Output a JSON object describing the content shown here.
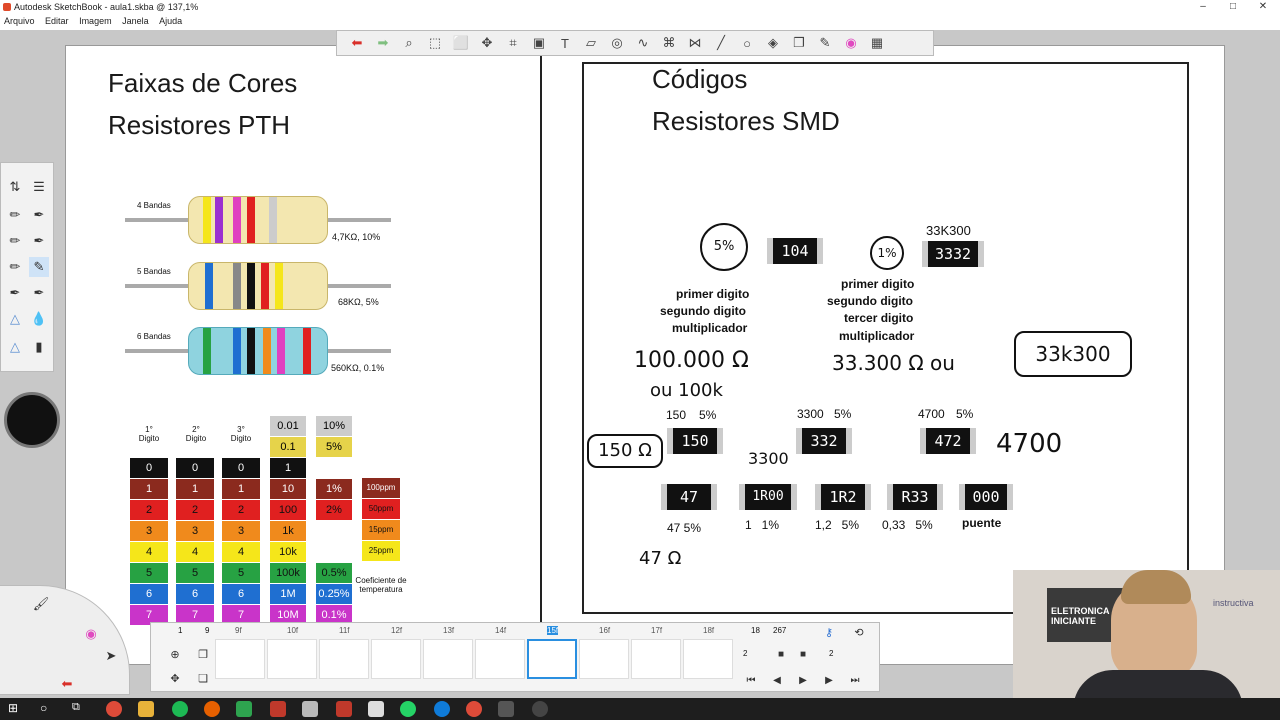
{
  "window": {
    "title": "Autodesk SketchBook - aula1.skba @ 137,1%",
    "minimize": "–",
    "maximize": "□",
    "close": "✕"
  },
  "menu": [
    "Arquivo",
    "Editar",
    "Imagem",
    "Janela",
    "Ajuda"
  ],
  "canvas": {
    "left_title_1": "Faixas de Cores",
    "left_title_2": "Resistores PTH",
    "right_title_1": "Códigos",
    "right_title_2": "Resistores SMD"
  },
  "pth": {
    "band_labels": [
      "4 Bandas",
      "5 Bandas",
      "6 Bandas"
    ],
    "values": [
      "4,7KΩ, 10%",
      "68KΩ, 5%",
      "560KΩ, 0.1%"
    ],
    "column_headers": [
      "1°\nDigito",
      "2°\nDigito",
      "3°\nDigito"
    ],
    "mult_top": [
      "0.01",
      "0.1"
    ],
    "tol_top": [
      "10%",
      "5%"
    ],
    "digits": [
      "0",
      "1",
      "2",
      "3",
      "4",
      "5",
      "6",
      "7"
    ],
    "multipliers": [
      "1",
      "10",
      "100",
      "1k",
      "10k",
      "100k",
      "1M",
      "10M"
    ],
    "tolerances": [
      "1%",
      "2%",
      "0.5%",
      "0.25%",
      "0.1%"
    ],
    "tempco": [
      "100ppm",
      "50ppm",
      "15ppm",
      "25ppm"
    ],
    "tempco_label": "Coeficiente de temperatura",
    "row_colors": [
      "#111111",
      "#8b2a1e",
      "#e02020",
      "#f08a1c",
      "#f5e61a",
      "#27a243",
      "#1f6fd1",
      "#c934c9",
      "#888888"
    ]
  },
  "smd": {
    "chip1": "104",
    "chip1_tol": "5%",
    "chip2": "3332",
    "chip2_tol": "1%",
    "chip2_top": "33K300",
    "labels1": [
      "primer digito",
      "segundo digito",
      "multiplicador"
    ],
    "labels2": [
      "primer digito",
      "segundo digito",
      "tercer digito",
      "multiplicador"
    ],
    "row2": [
      {
        "top": "150",
        "tol": "5%",
        "code": "150"
      },
      {
        "top": "3300",
        "tol": "5%",
        "code": "332"
      },
      {
        "top": "4700",
        "tol": "5%",
        "code": "472"
      }
    ],
    "row3": [
      {
        "code": "47",
        "bottom": "47 5%"
      },
      {
        "code": "1R00",
        "bottom": "1   1%"
      },
      {
        "code": "1R2",
        "bottom": "1,2   5%"
      },
      {
        "code": "R33",
        "bottom": "0,33   5%"
      },
      {
        "code": "000",
        "bottom": "puente"
      }
    ],
    "hand": {
      "h1": "100.000 Ω",
      "h2": "ou 100k",
      "h3": "33.300 Ω  ou",
      "h4": "33k300",
      "h5": "150 Ω",
      "h6": "3300",
      "h7": "4700",
      "h8": "47 Ω"
    }
  },
  "filmstrip": {
    "frames": [
      "9f",
      "10f",
      "11f",
      "12f",
      "13f",
      "14f",
      "15f",
      "16f",
      "17f",
      "18f"
    ],
    "active": "15f",
    "counter_left": "1",
    "counter_right": "9",
    "range_start": "18",
    "range_end": "267",
    "stepper_a": "2",
    "stepper_b": "2"
  },
  "webcam": {
    "overlay_title": "ELETRONICA INICIANTE",
    "brand": "instructiva"
  }
}
